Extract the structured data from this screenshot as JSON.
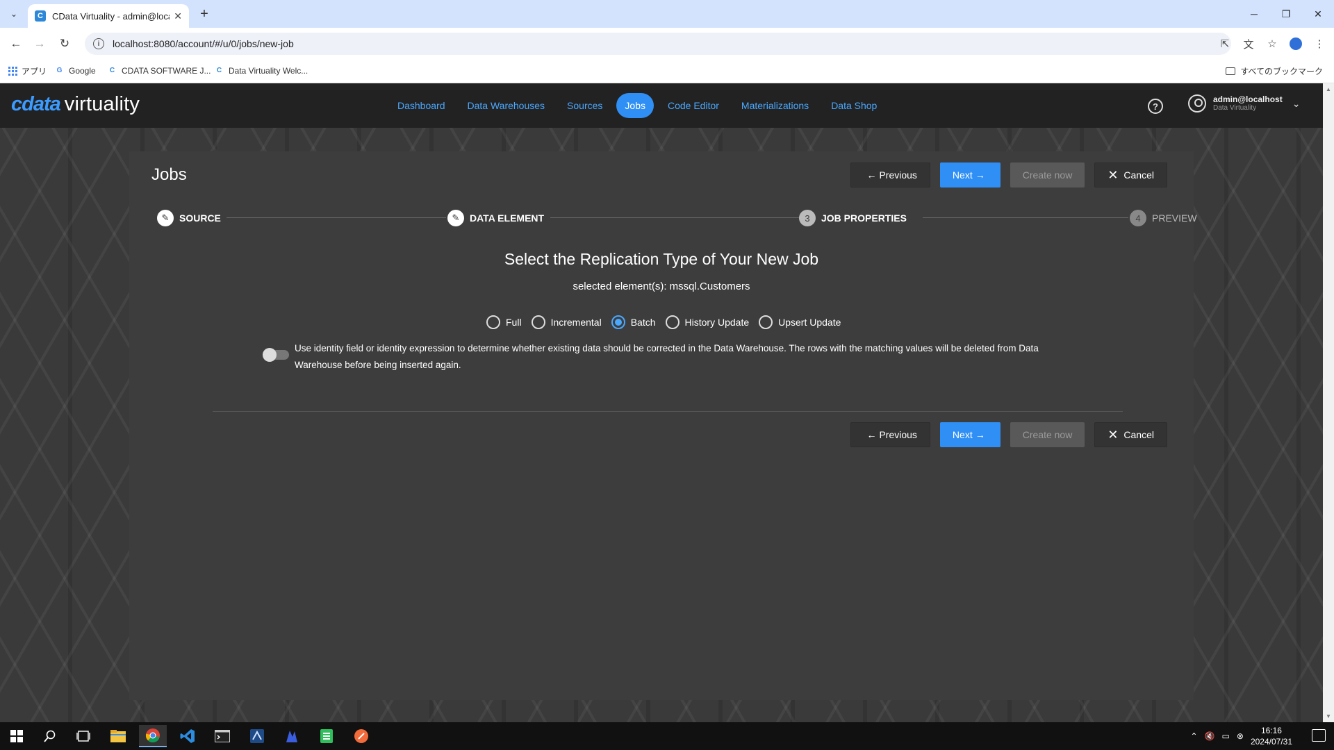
{
  "browser": {
    "tab_title": "CData Virtuality - admin@locall",
    "tab_favicon_letter": "C",
    "url": "localhost:8080/account/#/u/0/jobs/new-job",
    "bookmarks": [
      {
        "label": "アプリ"
      },
      {
        "label": "Google"
      },
      {
        "label": "CDATA SOFTWARE J..."
      },
      {
        "label": "Data Virtuality Welc..."
      }
    ],
    "bookmarks_folder": "すべてのブックマーク"
  },
  "app": {
    "logo_brand": "cdata",
    "logo_product": "virtuality",
    "nav": [
      {
        "label": "Dashboard",
        "active": false
      },
      {
        "label": "Data Warehouses",
        "active": false
      },
      {
        "label": "Sources",
        "active": false
      },
      {
        "label": "Jobs",
        "active": true
      },
      {
        "label": "Code Editor",
        "active": false
      },
      {
        "label": "Materializations",
        "active": false
      },
      {
        "label": "Data Shop",
        "active": false
      }
    ],
    "user": {
      "name": "admin@localhost",
      "org": "Data Virtuality"
    },
    "accent_color": "#2f8ff4"
  },
  "page": {
    "title": "Jobs",
    "buttons": {
      "previous": "Previous",
      "next": "Next",
      "create_now": "Create now",
      "cancel": "Cancel"
    },
    "steps": [
      {
        "label": "SOURCE",
        "state": "done",
        "icon": "pencil-icon"
      },
      {
        "label": "DATA ELEMENT",
        "state": "done",
        "icon": "pencil-icon"
      },
      {
        "label": "JOB PROPERTIES",
        "state": "current",
        "number": "3"
      },
      {
        "label": "PREVIEW",
        "state": "future",
        "number": "4"
      }
    ],
    "heading": "Select the Replication Type of Your New Job",
    "subheading": "selected element(s): mssql.Customers",
    "replication_types": [
      {
        "label": "Full",
        "checked": false
      },
      {
        "label": "Incremental",
        "checked": false
      },
      {
        "label": "Batch",
        "checked": true
      },
      {
        "label": "History Update",
        "checked": false
      },
      {
        "label": "Upsert Update",
        "checked": false
      }
    ],
    "identity_toggle_text": "Use identity field or identity expression to determine whether existing data should be corrected in the Data Warehouse. The rows with the matching values will be deleted from Data Warehouse before being inserted again.",
    "identity_toggle_on": false
  },
  "taskbar": {
    "time": "16:16",
    "date": "2024/07/31"
  }
}
